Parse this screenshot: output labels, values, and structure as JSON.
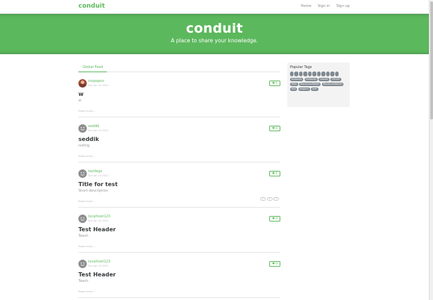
{
  "navbar": {
    "brand": "conduit",
    "links": [
      "Home",
      "Sign in",
      "Sign up"
    ]
  },
  "banner": {
    "title": "conduit",
    "subtitle": "A place to share your knowledge."
  },
  "feed": {
    "tab_label": "Global Feed"
  },
  "articles": [
    {
      "author": "rozpopov",
      "date": "Sun Jan 10 2021",
      "favorites": "1",
      "title": "w",
      "description": "w",
      "read_more": "Read more...",
      "avatar": "photo",
      "tag_pills": []
    },
    {
      "author": "seddik",
      "date": "Sun Jan 10 2021",
      "favorites": "0",
      "title": "seddik",
      "description": "nothig",
      "read_more": "Read more...",
      "avatar": "smiley",
      "tag_pills": []
    },
    {
      "author": "testlego",
      "date": "Sun Jan 10 2021",
      "favorites": "1",
      "title": "Title for test",
      "description": "Short description",
      "read_more": "Read more...",
      "avatar": "smiley",
      "tag_pills": [
        "1",
        "2",
        "3"
      ]
    },
    {
      "author": "localhost123",
      "date": "Sun Jan 10 2021",
      "favorites": "0",
      "title": "Test Header",
      "description": "Teach",
      "read_more": "Read more...",
      "avatar": "smiley",
      "tag_pills": []
    },
    {
      "author": "localhost123",
      "date": "Sun Jan 10 2021",
      "favorites": "0",
      "title": "Test Header",
      "description": "Teach",
      "read_more": "Read more...",
      "avatar": "smiley",
      "tag_pills": []
    }
  ],
  "sidebar": {
    "title": "Popular Tags",
    "blank_tag_count": 11,
    "tags": [
      "HuManity",
      "HuManity",
      "Gandhi",
      "HITLER",
      "SIDA",
      "BlackLivesMatter",
      "BlackLivesMatter",
      "test",
      "dragons",
      "butt"
    ]
  },
  "icons": {
    "favorite": "heart-icon",
    "avatar_default": "smiley-avatar-icon"
  },
  "colors": {
    "accent": "#5cb85c",
    "tag_bg": "#818a91"
  }
}
